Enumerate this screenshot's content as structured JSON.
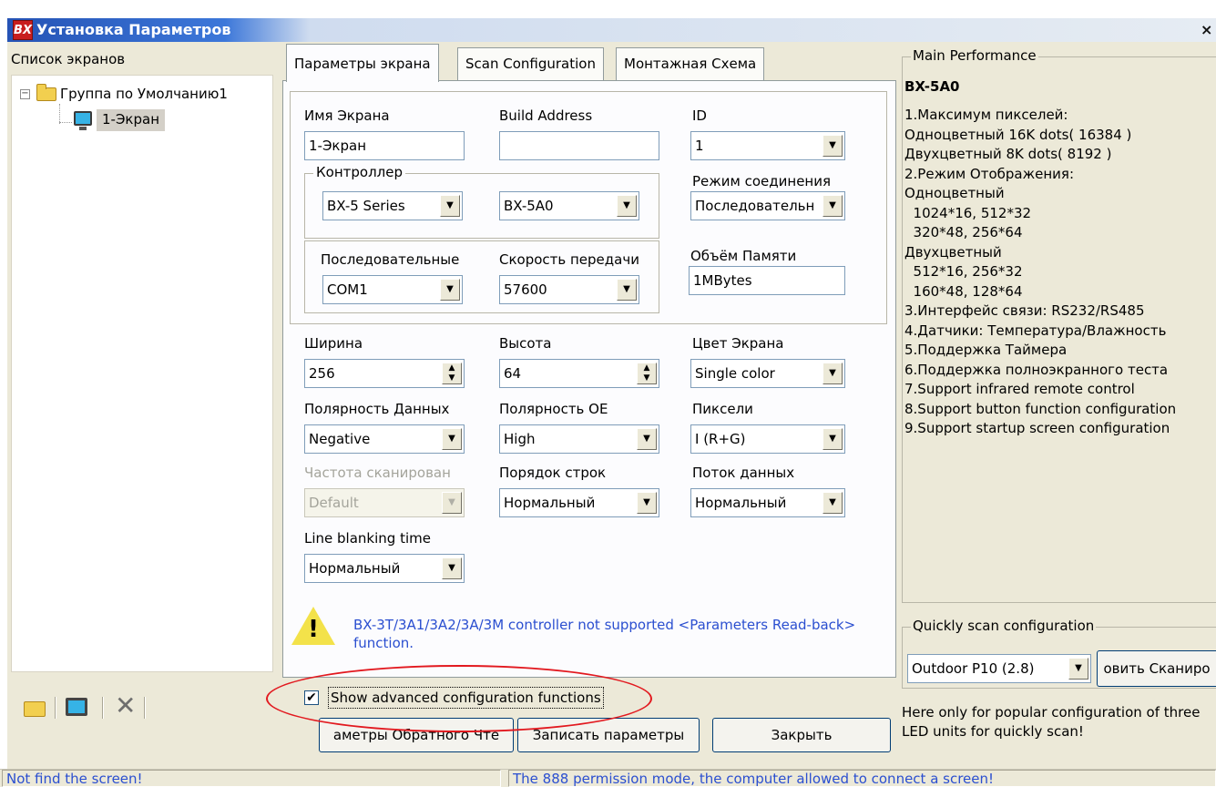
{
  "window": {
    "logo": "BX",
    "title": "Установка Параметров",
    "close": "×"
  },
  "left_panel": {
    "title": "Список экранов",
    "tree": {
      "toggle": "−",
      "group": "Группа по Умолчанию1",
      "screen": "1-Экран"
    },
    "toolbar": {
      "delete_glyph": "✕"
    }
  },
  "tabs": [
    "Параметры экрана",
    "Scan Configuration",
    "Монтажная Схема"
  ],
  "form": {
    "screen_name_label": "Имя Экрана",
    "screen_name_value": "1-Экран",
    "build_address_label": "Build Address",
    "build_address_value": "",
    "id_label": "ID",
    "id_value": "1",
    "controller_label": "Контроллер",
    "controller_series": "BX-5 Series",
    "controller_model": "BX-5A0",
    "connection_label": "Режим соединения",
    "connection_value": "Последовательн",
    "serial_label": "Последовательные",
    "serial_value": "COM1",
    "baud_label": "Скорость передачи",
    "baud_value": "57600",
    "memory_label": "Объём Памяти",
    "memory_value": "1MBytes",
    "width_label": "Ширина",
    "width_value": "256",
    "height_label": "Высота",
    "height_value": "64",
    "color_label": "Цвет Экрана",
    "color_value": "Single color",
    "data_polarity_label": "Полярность Данных",
    "data_polarity_value": "Negative",
    "oe_polarity_label": "Полярность ОЕ",
    "oe_polarity_value": "High",
    "pixels_label": "Пиксели",
    "pixels_value": "I  (R+G)",
    "scan_freq_label": "Частота сканирован",
    "scan_freq_value": "Default",
    "row_order_label": "Порядок строк",
    "row_order_value": "Нормальный",
    "data_flow_label": "Поток данных",
    "data_flow_value": "Нормальный",
    "line_blank_label": "Line blanking time",
    "line_blank_value": "Нормальный",
    "warning_text": "BX-3T/3A1/3A2/3A/3M controller not supported <Parameters Read-back> function.",
    "warning_glyph": "!"
  },
  "advanced": {
    "checked_glyph": "✔",
    "label": "Show advanced configuration functions"
  },
  "buttons": {
    "readback": "аметры Обратного Чте",
    "write": "Записать параметры",
    "close": "Закрыть"
  },
  "main_performance": {
    "title": "Main Performance",
    "model": "BX-5A0",
    "lines": [
      "1.Максимум пикселей:",
      "Одноцветный 16K dots( 16384 )",
      "Двухцветный 8K dots( 8192 )",
      "2.Режим Отображения:",
      "Одноцветный",
      "  1024*16, 512*32",
      "  320*48, 256*64",
      "Двухцветный",
      "  512*16, 256*32",
      "  160*48, 128*64",
      "3.Интерфейс связи: RS232/RS485",
      "4.Датчики: Температура/Влажность",
      "5.Поддержка Таймера",
      "6.Поддержка полноэкранного теста",
      "7.Support infrared remote control",
      "8.Support button function configuration",
      "9.Support startup screen configuration"
    ]
  },
  "quick_scan": {
    "title": "Quickly scan configuration",
    "preset": "Outdoor P10 (2.8)",
    "apply_button": "овить Сканиро",
    "note": "Here only for popular configuration of three LED units for quickly scan!"
  },
  "status": {
    "left": "Not find the screen!",
    "right": "The 888 permission mode, the computer allowed to connect a screen!"
  },
  "colors": {
    "titlebar_blue": "#2553b5",
    "accent_red": "#e2191f",
    "link_blue": "#2b4fd0",
    "dialog_bg": "#ece9d8"
  }
}
